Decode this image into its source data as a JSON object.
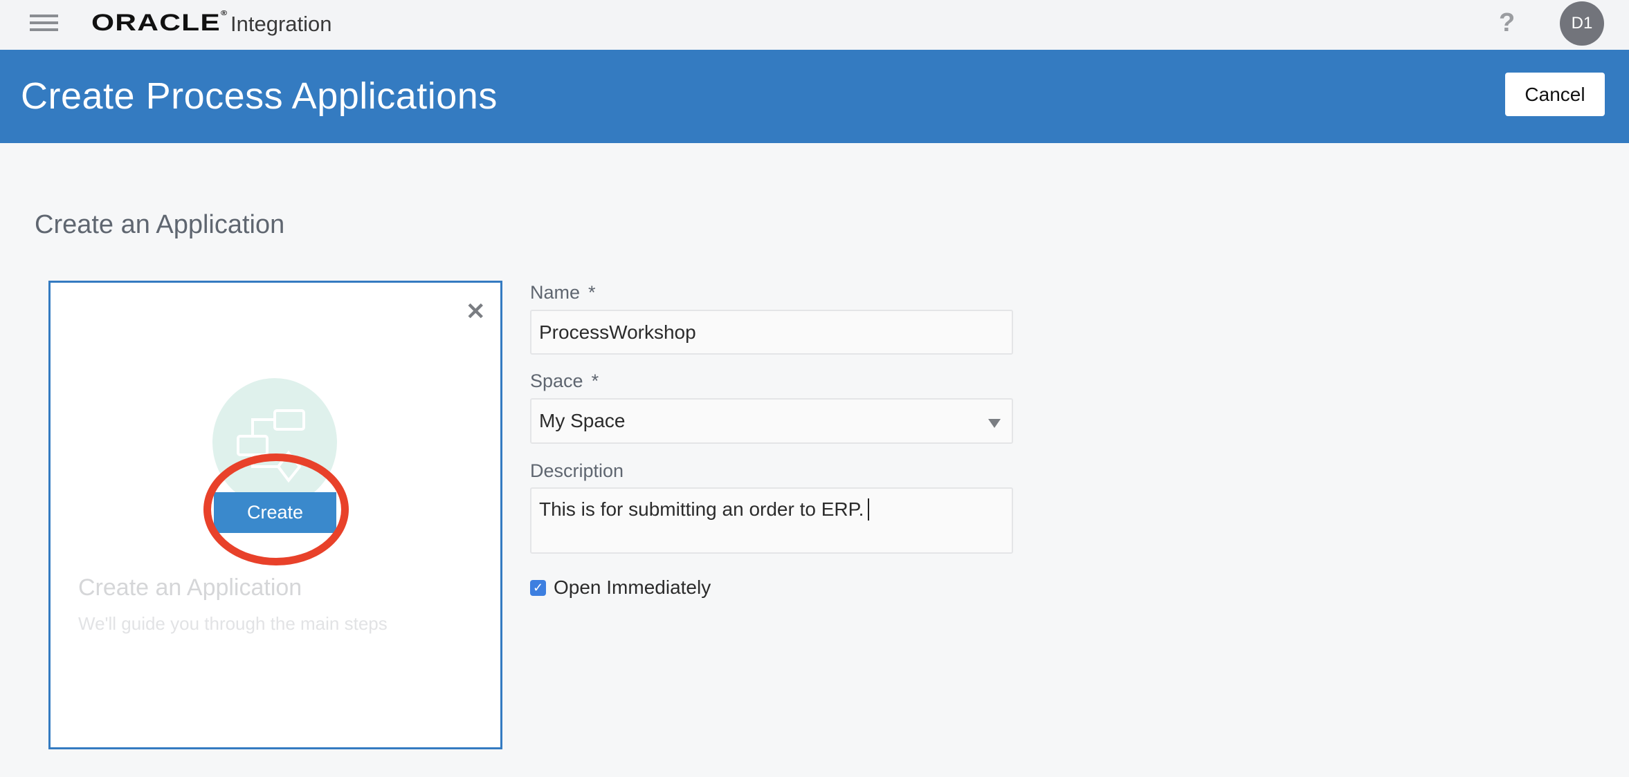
{
  "header": {
    "logo": "ORACLE",
    "product": "Integration",
    "help_icon": "question-mark-icon",
    "avatar_initials": "D1"
  },
  "banner": {
    "title": "Create Process Applications",
    "cancel_label": "Cancel",
    "color": "#347bc1"
  },
  "page": {
    "heading": "Create an Application"
  },
  "card": {
    "create_label": "Create",
    "title": "Create an Application",
    "subtitle": "We'll guide you through the main steps"
  },
  "form": {
    "name_label": "Name",
    "name_value": "ProcessWorkshop",
    "space_label": "Space",
    "space_value": "My Space",
    "description_label": "Description",
    "description_value": "This is for submitting an order to ERP.",
    "required_marker": "*",
    "open_immediately_label": "Open Immediately",
    "open_immediately_checked": true
  }
}
